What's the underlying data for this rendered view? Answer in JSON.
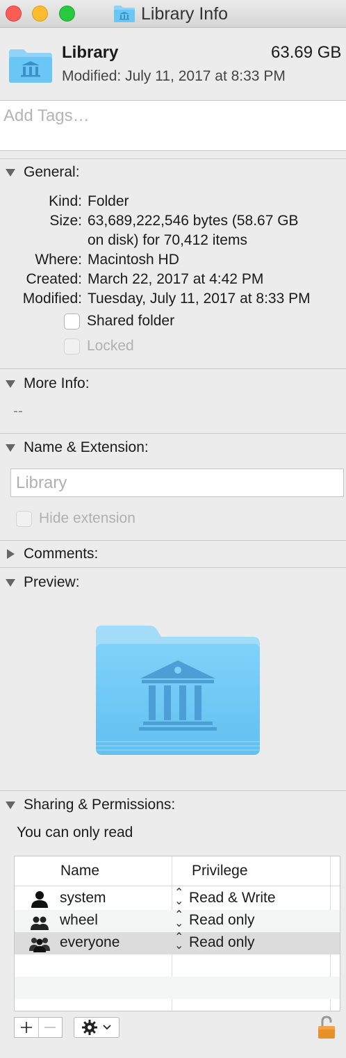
{
  "window": {
    "title": "Library Info"
  },
  "header": {
    "name": "Library",
    "size": "63.69 GB",
    "modified_label": "Modified:",
    "modified_value": "July 11, 2017 at 8:33 PM"
  },
  "tags": {
    "placeholder": "Add Tags…"
  },
  "general": {
    "title": "General:",
    "rows": [
      {
        "key": "Kind:",
        "value": "Folder"
      },
      {
        "key": "Size:",
        "value": "63,689,222,546 bytes (58.67 GB"
      },
      {
        "key": "",
        "value": "on disk) for 70,412 items"
      },
      {
        "key": "Where:",
        "value": "Macintosh HD"
      },
      {
        "key": "Created:",
        "value": "March 22, 2017 at 4:42 PM"
      },
      {
        "key": "Modified:",
        "value": "Tuesday, July 11, 2017 at 8:33 PM"
      }
    ],
    "shared_folder_label": "Shared folder",
    "locked_label": "Locked"
  },
  "more_info": {
    "title": "More Info:",
    "value": "--"
  },
  "name_extension": {
    "title": "Name & Extension:",
    "name_value": "Library",
    "hide_extension_label": "Hide extension"
  },
  "comments": {
    "title": "Comments:"
  },
  "preview": {
    "title": "Preview:"
  },
  "sharing": {
    "title": "Sharing & Permissions:",
    "status": "You can only read",
    "columns": {
      "name": "Name",
      "privilege": "Privilege"
    },
    "rows": [
      {
        "name": "system",
        "privilege": "Read & Write",
        "icon": "user-icon"
      },
      {
        "name": "wheel",
        "privilege": "Read only",
        "icon": "group-icon"
      },
      {
        "name": "everyone",
        "privilege": "Read only",
        "icon": "everyone-icon"
      }
    ]
  },
  "colors": {
    "folder_blue": "#6ac6f5",
    "folder_tab": "#8fd4f8",
    "lock_orange": "#e8912b"
  }
}
